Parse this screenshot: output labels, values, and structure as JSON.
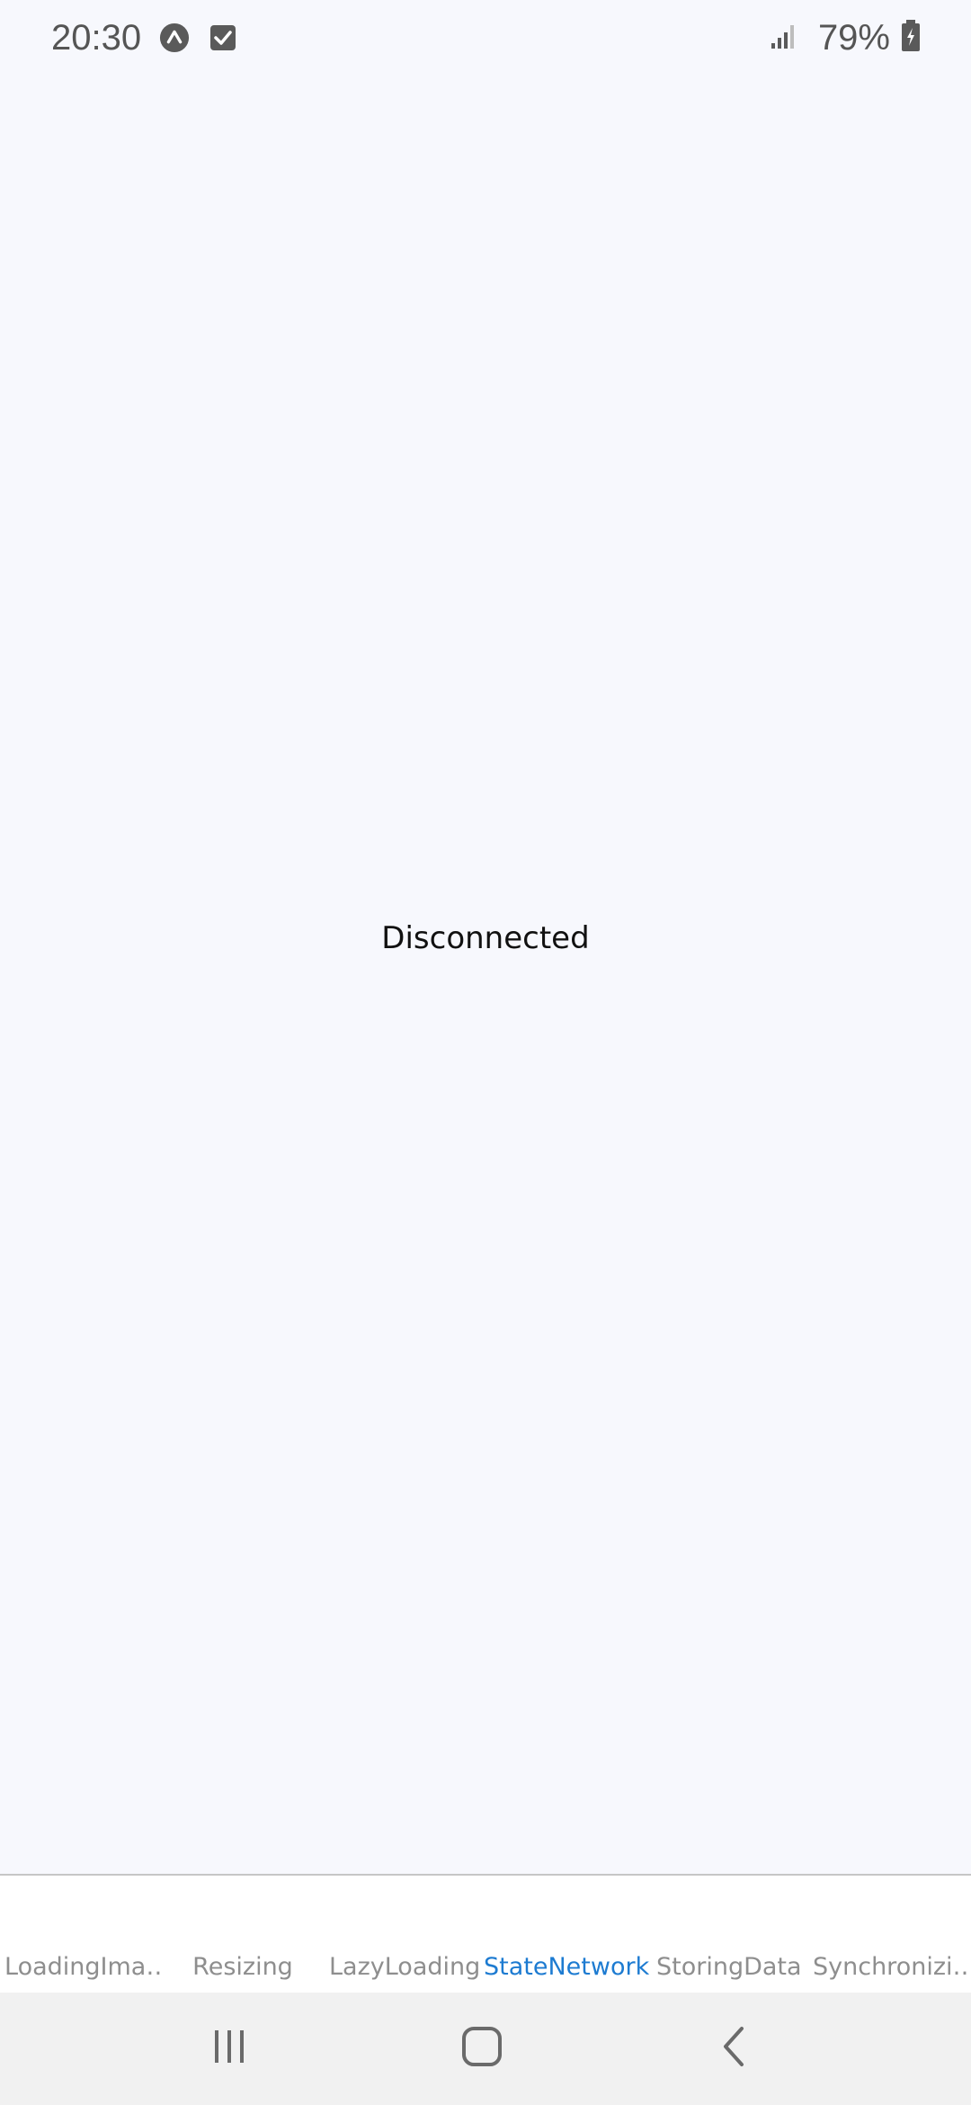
{
  "status_bar": {
    "time": "20:30",
    "battery_percent": "79%",
    "notification_icons": [
      "app-arrow-icon",
      "checkbox-icon"
    ],
    "signal_icon": "signal-icon",
    "battery_icon": "battery-charging-icon"
  },
  "main": {
    "connection_status": "Disconnected"
  },
  "tabs": [
    {
      "label": "LoadingIma…",
      "active": false
    },
    {
      "label": "Resizing",
      "active": false
    },
    {
      "label": "LazyLoading",
      "active": false
    },
    {
      "label": "StateNetwork",
      "active": true
    },
    {
      "label": "StoringData",
      "active": false
    },
    {
      "label": "Synchronizi…",
      "active": false
    }
  ],
  "nav_bar": {
    "buttons": [
      "recent-apps-icon",
      "home-icon",
      "back-icon"
    ]
  },
  "colors": {
    "background": "#f7f8fd",
    "tab_active": "#1d7bd1",
    "tab_inactive": "#8e8e8e"
  }
}
